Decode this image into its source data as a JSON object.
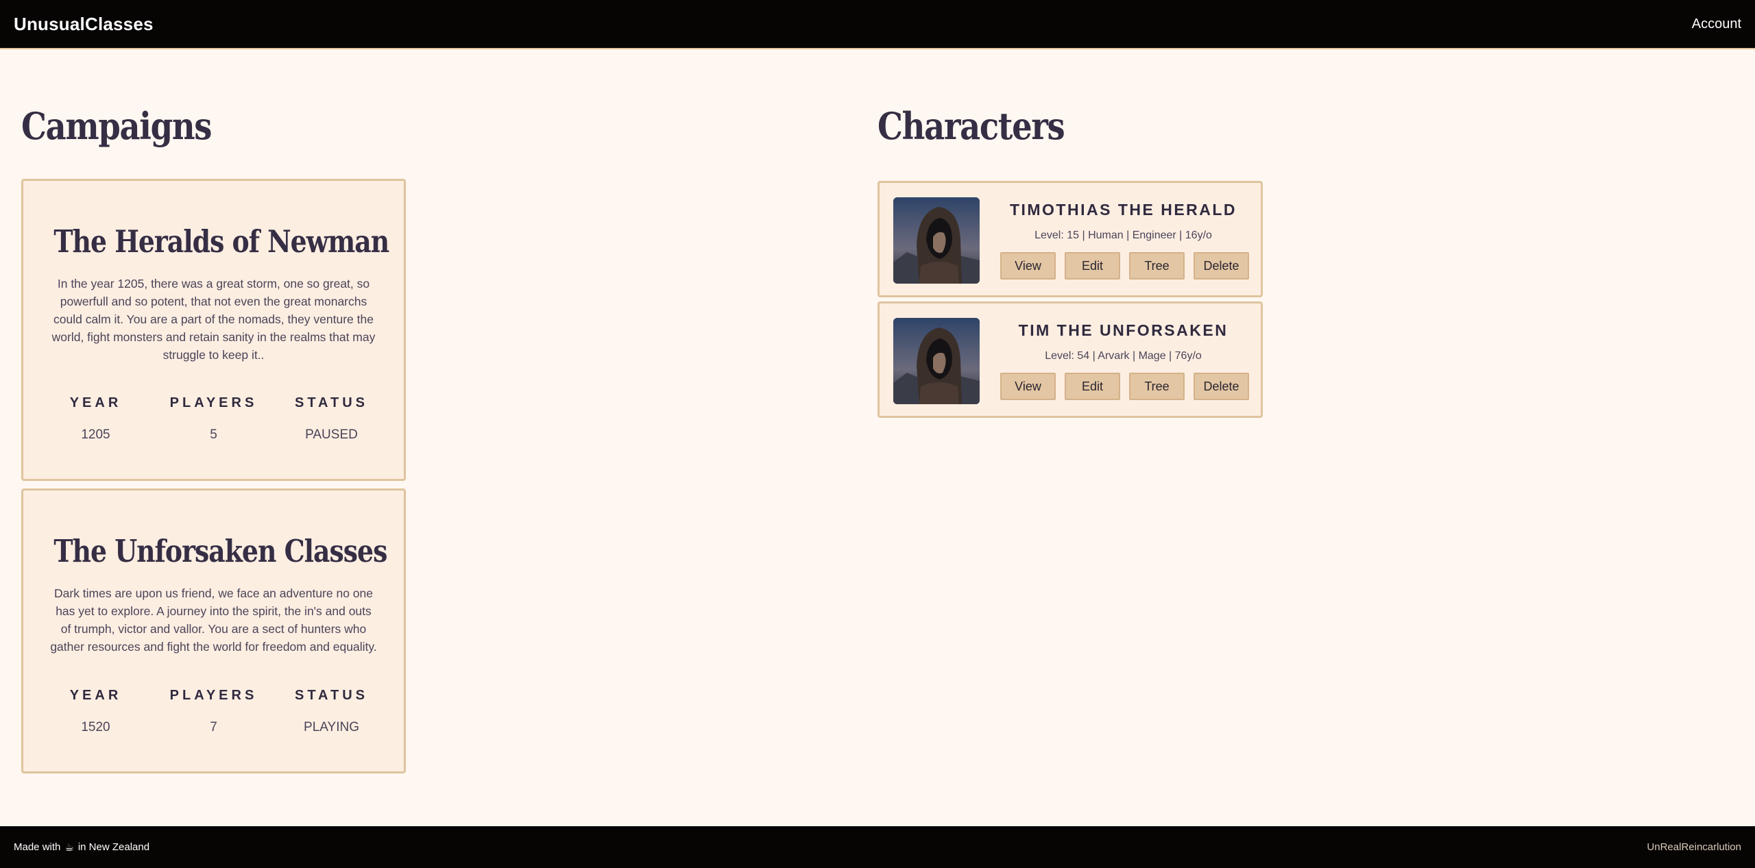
{
  "header": {
    "brand": "UnusualClasses",
    "account_label": "Account"
  },
  "campaigns": {
    "title": "Campaigns",
    "stat_labels": {
      "year": "YEAR",
      "players": "PLAYERS",
      "status": "STATUS"
    },
    "items": [
      {
        "name": "The Heralds of Newman",
        "description": "In the year 1205, there was a great storm, one so great, so powerfull and so potent, that not even the great monarchs could calm it. You are a part of the nomads, they venture the world, fight monsters and retain sanity in the realms that may struggle to keep it..",
        "year": "1205",
        "players": "5",
        "status": "PAUSED"
      },
      {
        "name": "The Unforsaken Classes",
        "description": "Dark times are upon us friend, we face an adventure no one has yet to explore. A journey into the spirit, the in's and outs of trumph, victor and vallor. You are a sect of hunters who gather resources and fight the world for freedom and equality.",
        "year": "1520",
        "players": "7",
        "status": "PLAYING"
      }
    ]
  },
  "characters": {
    "title": "Characters",
    "button_labels": {
      "view": "View",
      "edit": "Edit",
      "tree": "Tree",
      "delete": "Delete"
    },
    "items": [
      {
        "name": "TIMOTHIAS THE HERALD",
        "meta": "Level: 15 | Human | Engineer | 16y/o"
      },
      {
        "name": "TIM THE UNFORSAKEN",
        "meta": "Level: 54 | Arvark | Mage | 76y/o"
      }
    ]
  },
  "footer": {
    "made_with": "Made with",
    "icon": "coffee-icon",
    "location": "in New Zealand",
    "credit": "UnRealReincarlution"
  }
}
